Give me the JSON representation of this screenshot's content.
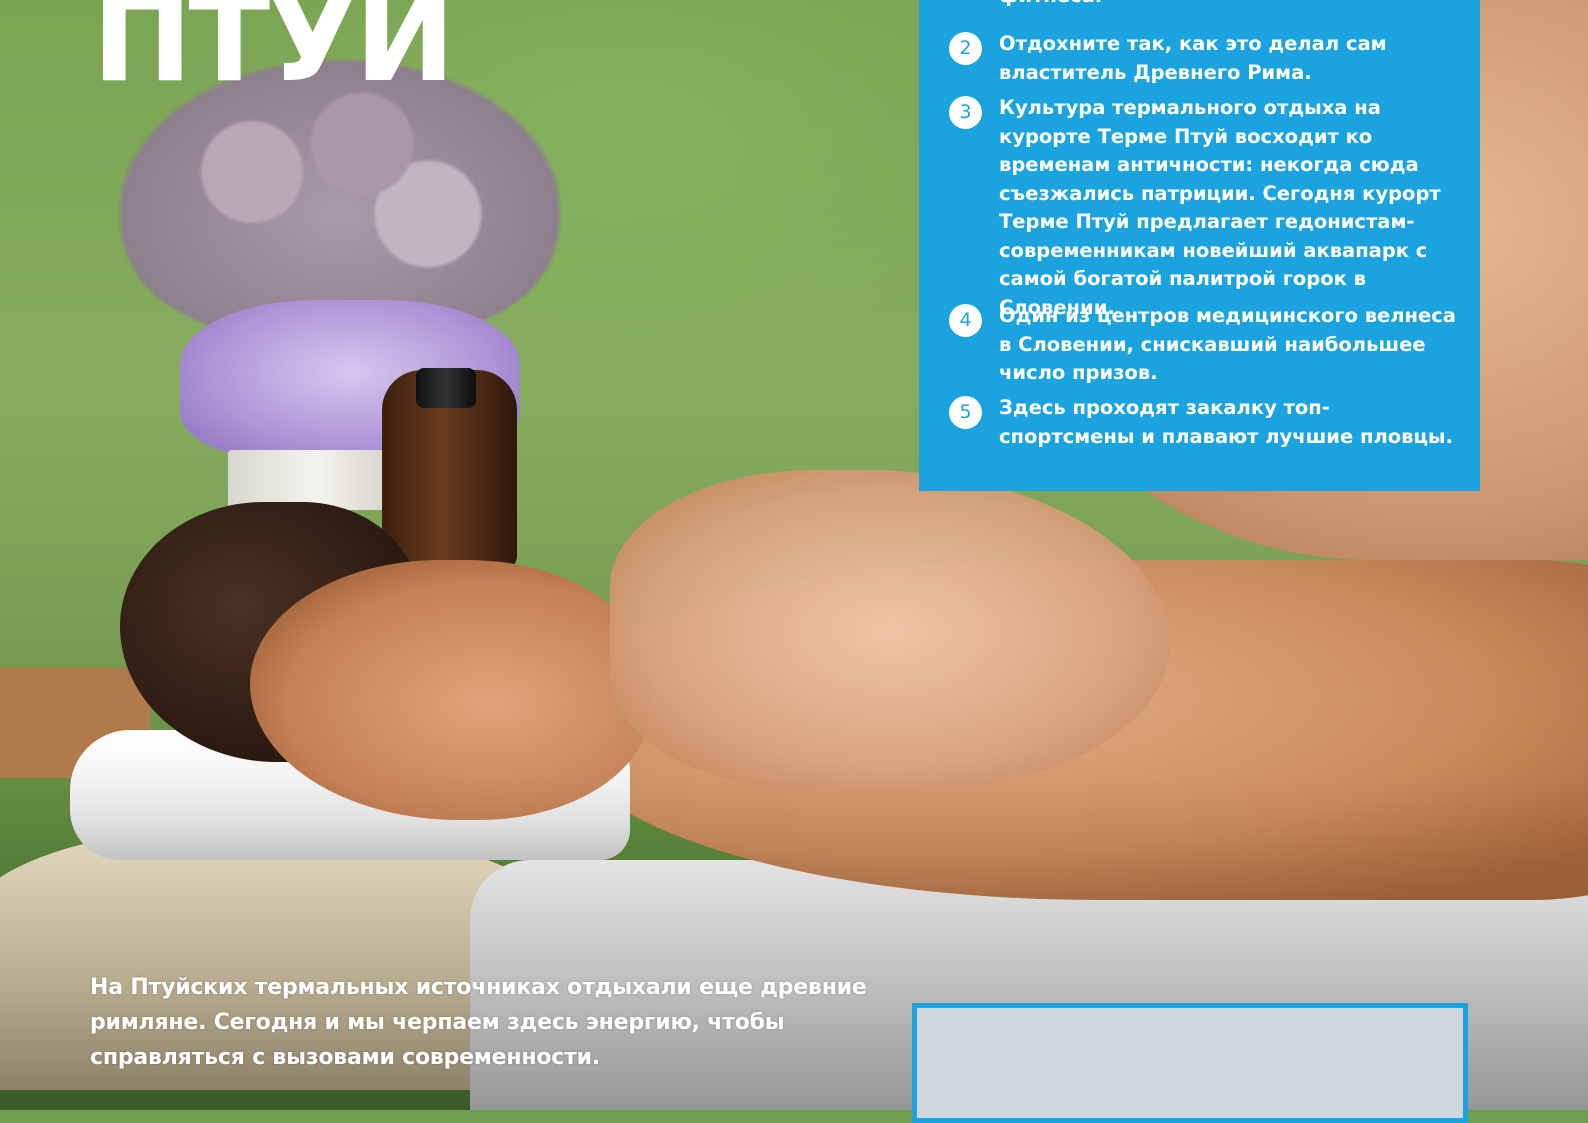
{
  "title": "ПТУЙ",
  "list": [
    {
      "number": "",
      "text": "фитнеса."
    },
    {
      "number": "2",
      "text": "Отдохните так, как это делал сам властитель Древнего Рима."
    },
    {
      "number": "3",
      "text": "Культура термального отдыха на курорте Терме Птуй восходит ко временам античности: некогда сюда съезжались патриции. Сегодня курорт Терме Птуй предлагает гедонистам-современникам новейший аквапарк с самой богатой палитрой горок в Словении."
    },
    {
      "number": "4",
      "text": "Один из центров медицинского велнеса в Словении, снискавший наибольшее число призов."
    },
    {
      "number": "5",
      "text": "Здесь проходят закалку топ-спортсмены и плавают лучшие пловцы."
    }
  ],
  "caption": "На Птуйских термальных источниках отдыхали еще древние римляне. Сегодня и мы черпаем здесь энергию, чтобы справляться с вызовами современности.",
  "colors": {
    "accent": "#1ba3df",
    "text": "#ffffff"
  },
  "photo": "massage-photo"
}
